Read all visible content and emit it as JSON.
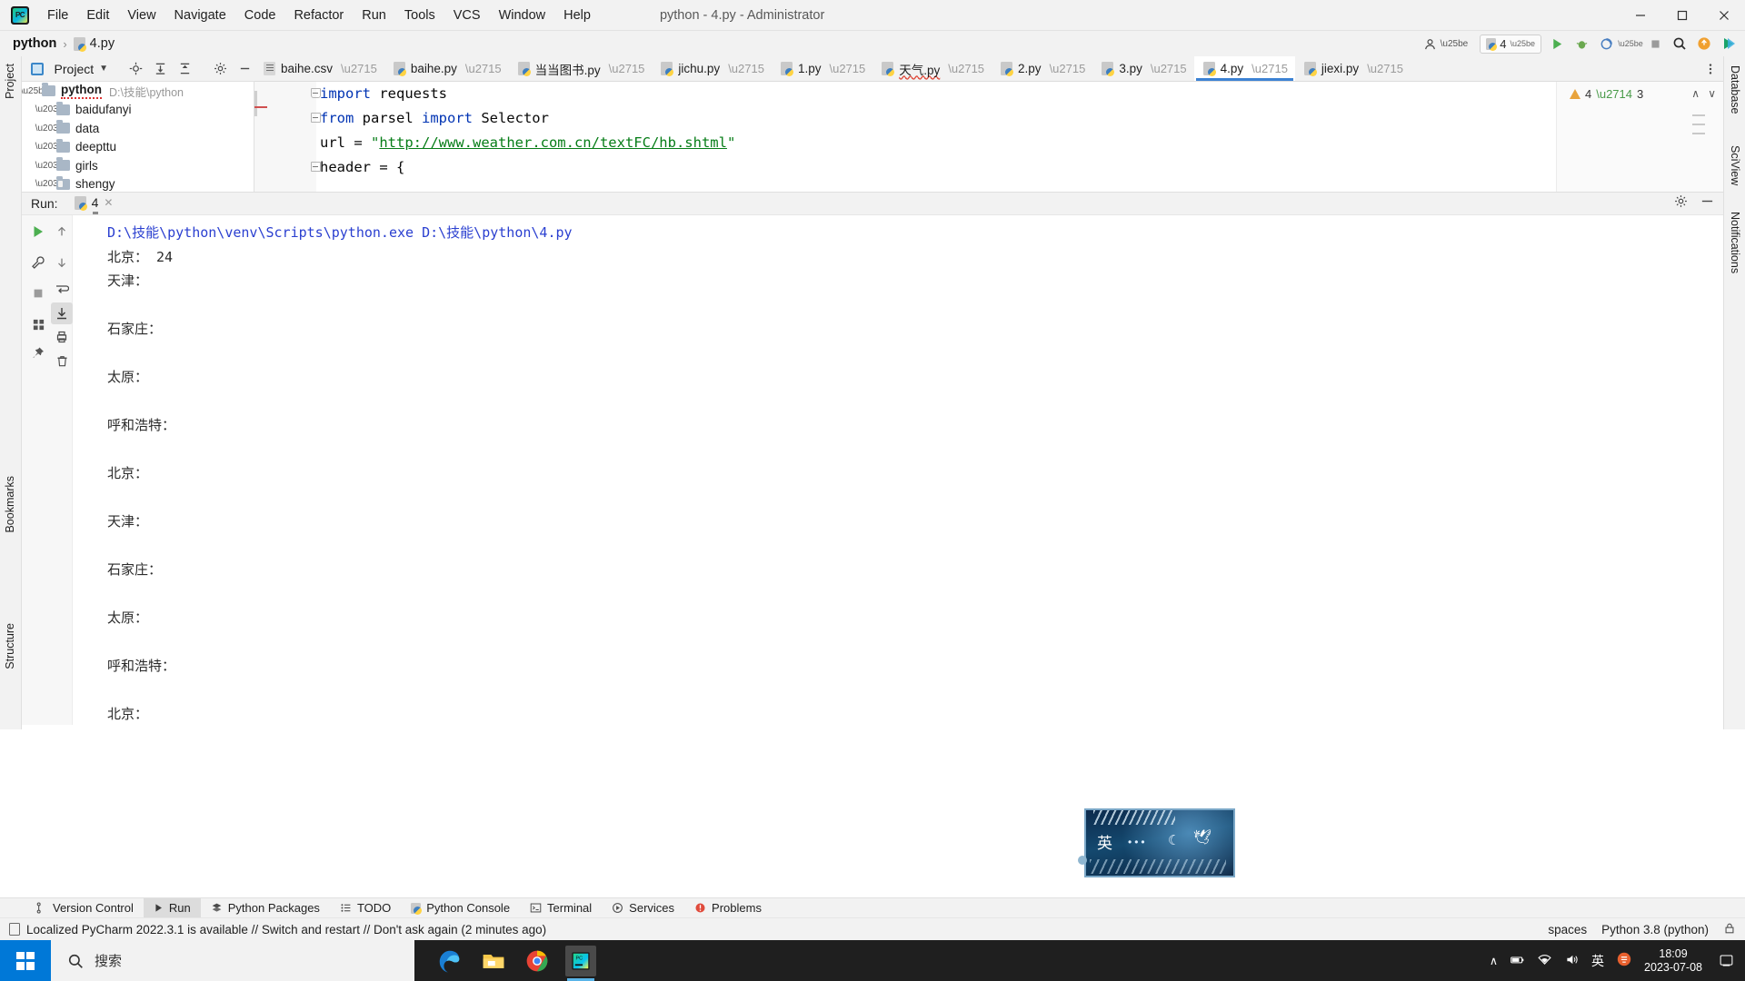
{
  "titlebar": {
    "app_icon": "pycharm-logo",
    "menus": [
      "File",
      "Edit",
      "View",
      "Navigate",
      "Code",
      "Refactor",
      "Run",
      "Tools",
      "VCS",
      "Window",
      "Help"
    ],
    "window_title": "python - 4.py - Administrator",
    "minimize": "–",
    "maximize": "❐",
    "close": "✕"
  },
  "navbar": {
    "project_name": "python",
    "separator": "›",
    "file_name": "4.py",
    "account_icon": "account-icon",
    "run_config": "4",
    "run_icon": "run-icon",
    "debug_icon": "debug-icon",
    "coverage_icon": "coverage-icon",
    "profile_icon": "profile-icon",
    "stop_icon": "stop-icon",
    "search_icon": "search-icon",
    "updates_icon": "updates-icon",
    "ide_icon": "ide-icon"
  },
  "project_tool": {
    "title": "Project",
    "dropdown": "▼",
    "locate_icon": "locate-icon",
    "expand_icon": "expand-all-icon",
    "collapse_icon": "collapse-all-icon",
    "settings_icon": "gear-icon",
    "hide_icon": "minimize-icon",
    "tree": [
      {
        "label": "python",
        "path": "D:\\技能\\python",
        "expanded": true,
        "depth": 0
      },
      {
        "label": "baidufanyi",
        "path": "",
        "expanded": false,
        "depth": 1
      },
      {
        "label": "data",
        "path": "",
        "expanded": false,
        "depth": 1
      },
      {
        "label": "deepttu",
        "path": "",
        "expanded": false,
        "depth": 1
      },
      {
        "label": "girls",
        "path": "",
        "expanded": false,
        "depth": 1
      },
      {
        "label": "shengy",
        "path": "",
        "expanded": false,
        "depth": 1
      }
    ]
  },
  "left_rail": [
    "Project",
    "Bookmarks",
    "Structure"
  ],
  "right_rail": [
    "Database",
    "SciView",
    "Notifications"
  ],
  "editor_tabs": [
    {
      "label": "baihe.csv",
      "type": "csv",
      "active": false,
      "squiggly": false
    },
    {
      "label": "baihe.py",
      "type": "py",
      "active": false,
      "squiggly": false
    },
    {
      "label": "当当图书.py",
      "type": "py",
      "active": false,
      "squiggly": false
    },
    {
      "label": "jichu.py",
      "type": "py",
      "active": false,
      "squiggly": false
    },
    {
      "label": "1.py",
      "type": "py",
      "active": false,
      "squiggly": false
    },
    {
      "label": "天气.py",
      "type": "py",
      "active": false,
      "squiggly": true
    },
    {
      "label": "2.py",
      "type": "py",
      "active": false,
      "squiggly": false
    },
    {
      "label": "3.py",
      "type": "py",
      "active": false,
      "squiggly": false
    },
    {
      "label": "4.py",
      "type": "py",
      "active": true,
      "squiggly": false
    },
    {
      "label": "jiexi.py",
      "type": "py",
      "active": false,
      "squiggly": false
    }
  ],
  "editor": {
    "lines": [
      {
        "num": "1",
        "fold": true,
        "segments": [
          {
            "t": "import",
            "c": "kw"
          },
          {
            "t": " requests",
            "c": ""
          }
        ]
      },
      {
        "num": "2",
        "fold": true,
        "segments": [
          {
            "t": "from",
            "c": "kw"
          },
          {
            "t": " parsel ",
            "c": ""
          },
          {
            "t": "import",
            "c": "kw"
          },
          {
            "t": " Selector",
            "c": ""
          }
        ]
      },
      {
        "num": "3",
        "fold": false,
        "segments": [
          {
            "t": "url = ",
            "c": ""
          },
          {
            "t": "\"",
            "c": "str"
          },
          {
            "t": "http://www.weather.com.cn/textFC/hb.shtml",
            "c": "url"
          },
          {
            "t": "\"",
            "c": "str"
          }
        ]
      },
      {
        "num": "4",
        "fold": true,
        "segments": [
          {
            "t": "header = {",
            "c": ""
          }
        ]
      }
    ],
    "warnings_count": "4",
    "checks_count": "3",
    "warning_icon": "warning-triangle-icon",
    "check_icon": "checkmark-icon",
    "prev_icon": "∧",
    "next_icon": "∨"
  },
  "run_panel": {
    "label": "Run:",
    "tab_name": "4",
    "tab_icon": "python-icon",
    "close_icon": "✕",
    "settings_icon": "gear-icon",
    "hide_icon": "minimize-icon",
    "toolbar": [
      {
        "name": "rerun-button",
        "glyph": "▶"
      },
      {
        "name": "scroll-up-button",
        "glyph": "↑"
      },
      {
        "name": "wrench-button",
        "glyph": "⚒"
      },
      {
        "name": "scroll-down-button",
        "glyph": "↓"
      },
      {
        "name": "stop-button",
        "glyph": "■"
      },
      {
        "name": "soft-wrap-button",
        "glyph": "↵"
      },
      {
        "name": "scroll-to-end-button",
        "glyph": "⤓"
      },
      {
        "name": "grid-button",
        "glyph": "▦"
      },
      {
        "name": "print-button",
        "glyph": "⎙"
      },
      {
        "name": "pin-button",
        "glyph": "✐"
      },
      {
        "name": "clear-all-button",
        "glyph": "Ὕ1"
      }
    ],
    "console_lines": [
      {
        "text": "D:\\技能\\python\\venv\\Scripts\\python.exe D:\\技能\\python\\4.py",
        "kind": "cmd"
      },
      {
        "text": "北京： 24",
        "kind": "out"
      },
      {
        "text": "天津：",
        "kind": "out"
      },
      {
        "text": "",
        "kind": "out"
      },
      {
        "text": "石家庄：",
        "kind": "out"
      },
      {
        "text": "",
        "kind": "out"
      },
      {
        "text": "太原：",
        "kind": "out"
      },
      {
        "text": "",
        "kind": "out"
      },
      {
        "text": "呼和浩特：",
        "kind": "out"
      },
      {
        "text": "",
        "kind": "out"
      },
      {
        "text": "北京：",
        "kind": "out"
      },
      {
        "text": "",
        "kind": "out"
      },
      {
        "text": "天津：",
        "kind": "out"
      },
      {
        "text": "",
        "kind": "out"
      },
      {
        "text": "石家庄：",
        "kind": "out"
      },
      {
        "text": "",
        "kind": "out"
      },
      {
        "text": "太原：",
        "kind": "out"
      },
      {
        "text": "",
        "kind": "out"
      },
      {
        "text": "呼和浩特：",
        "kind": "out"
      },
      {
        "text": "",
        "kind": "out"
      },
      {
        "text": "北京：",
        "kind": "out"
      }
    ]
  },
  "bottom_tabs": [
    {
      "label": "Version Control",
      "icon": "branch-icon",
      "active": false
    },
    {
      "label": "Run",
      "icon": "run-icon",
      "active": true
    },
    {
      "label": "Python Packages",
      "icon": "packages-icon",
      "active": false
    },
    {
      "label": "TODO",
      "icon": "todo-icon",
      "active": false
    },
    {
      "label": "Python Console",
      "icon": "python-icon",
      "active": false
    },
    {
      "label": "Terminal",
      "icon": "terminal-icon",
      "active": false
    },
    {
      "label": "Services",
      "icon": "services-icon",
      "active": false
    },
    {
      "label": "Problems",
      "icon": "problems-icon",
      "active": false
    }
  ],
  "statusbar": {
    "message": "Localized PyCharm 2022.3.1 is available // Switch and restart // Don't ask again (2 minutes ago)",
    "message_icon": "notification-icon",
    "indent": "spaces",
    "interpreter": "Python 3.8 (python)",
    "lock_icon": "lock-icon"
  },
  "taskbar": {
    "start_icon": "windows-start-icon",
    "search_icon": "search-icon",
    "search_placeholder": "搜索",
    "apps": [
      {
        "name": "edge-icon",
        "glyph": "e"
      },
      {
        "name": "file-explorer-icon",
        "glyph": "🖿"
      },
      {
        "name": "chrome-icon",
        "glyph": "●"
      },
      {
        "name": "pycharm-icon",
        "glyph": "PC"
      }
    ],
    "tray": {
      "chevron": "∧",
      "battery_icon": "battery-icon",
      "network_icon": "network-icon",
      "volume_icon": "volume-icon",
      "ime_label": "英",
      "sogou_icon": "sogou-icon",
      "time": "18:09",
      "date": "2023-07-08",
      "notification_icon": "notification-center-icon"
    }
  },
  "float_widget": {
    "label": "英",
    "dots": "•••",
    "moon": "☾",
    "bird": "🕊"
  }
}
